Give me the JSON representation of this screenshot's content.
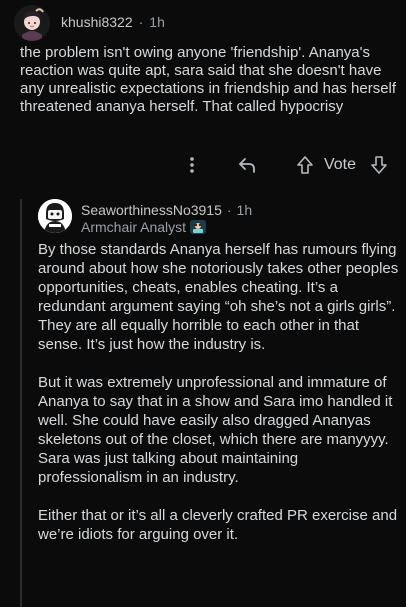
{
  "top_comment": {
    "username": "khushi8322",
    "separator": "·",
    "time": "1h",
    "body": "the problem isn't owing anyone 'friendship'. Ananya's reaction was quite apt, sara said that she doesn't have any unrealistic expectations in friendship and has herself threatened ananya herself. That called hypocrisy"
  },
  "actions": {
    "more_icon": "more-vertical-icon",
    "reply_icon": "reply-arrow-icon",
    "upvote_icon": "upvote-arrow-icon",
    "vote_label": "Vote",
    "downvote_icon": "downvote-arrow-icon"
  },
  "reply": {
    "username": "SeaworthinessNo3915",
    "separator": "·",
    "time": "1h",
    "flair_text": "Armchair Analyst",
    "flair_icon": "analyst-emoji-icon",
    "paragraphs": [
      "By those standards Ananya herself has rumours flying around about how she notoriously takes other peoples opportunities, cheats, enables cheating. It’s a redundant argument saying “oh she’s not a girls girls”. They are all equally horrible to each other in that sense. It’s just how the industry is.",
      "But it was extremely unprofessional and immature of Ananya to say that in a show and Sara imo handled it well. She could have easily also dragged Ananyas skeletons out of the closet, which there are manyyyy. Sara was just talking about maintaining professionalism in an industry.",
      "Either that or it’s all a cleverly crafted PR exercise and we’re idiots for arguing over it."
    ]
  },
  "colors": {
    "background": "#0b0b0c",
    "text": "#d7dadc",
    "meta": "#9aa0a6",
    "thread_line": "#2b2c2e"
  }
}
